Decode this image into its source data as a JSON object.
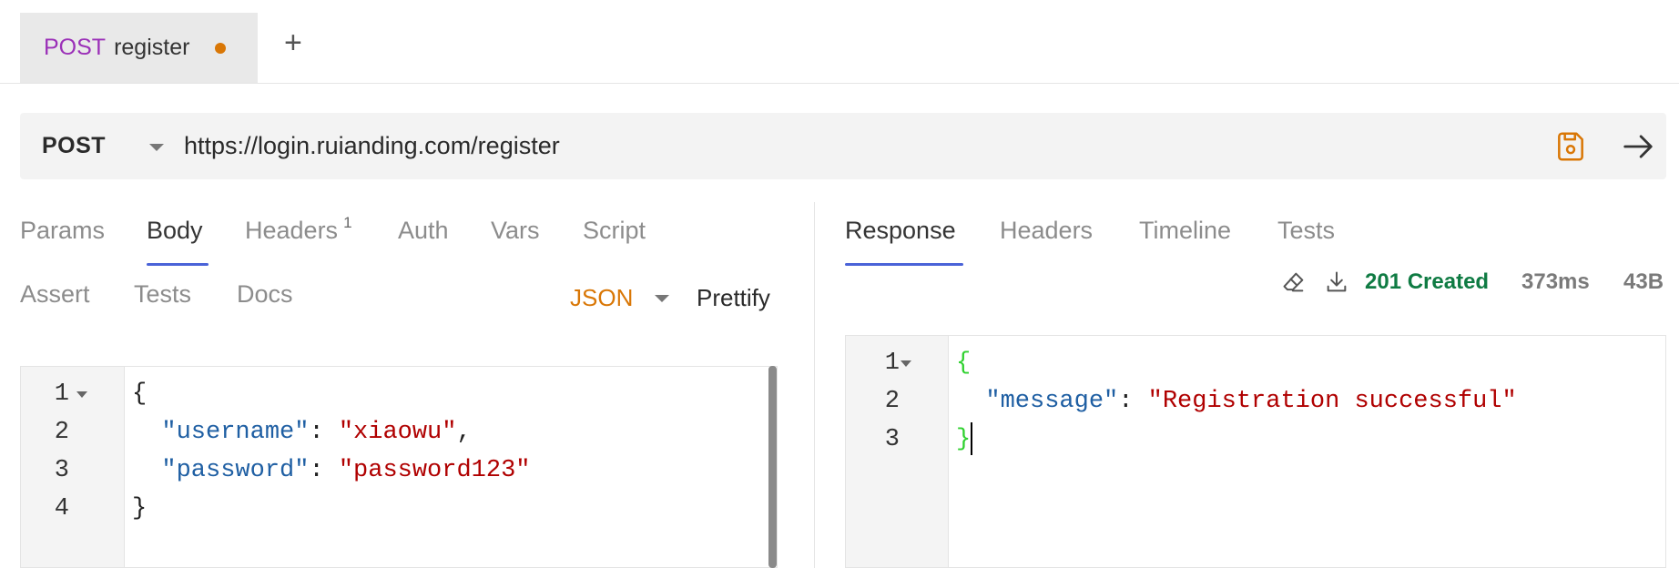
{
  "tab_strip": {
    "active_tab": {
      "method": "POST",
      "name": "register",
      "unsaved": true
    },
    "new_tab_label": "+"
  },
  "url_bar": {
    "method": "POST",
    "url": "https://login.ruianding.com/register",
    "icons": {
      "save": "save-icon",
      "send": "arrow-right-icon"
    }
  },
  "request_pane": {
    "tabs": [
      {
        "label": "Params"
      },
      {
        "label": "Body",
        "active": true
      },
      {
        "label": "Headers",
        "badge": "1"
      },
      {
        "label": "Auth"
      },
      {
        "label": "Vars"
      },
      {
        "label": "Script"
      },
      {
        "label": "Assert"
      },
      {
        "label": "Tests"
      },
      {
        "label": "Docs"
      }
    ],
    "body_mode": "JSON",
    "prettify_label": "Prettify",
    "body_lines": [
      "1",
      "2",
      "3",
      "4"
    ],
    "body": {
      "open": "{",
      "username_key": "\"username\"",
      "username_value": "\"xiaowu\"",
      "password_key": "\"password\"",
      "password_value": "\"password123\"",
      "close": "}"
    }
  },
  "response_pane": {
    "tabs": [
      {
        "label": "Response",
        "active": true
      },
      {
        "label": "Headers"
      },
      {
        "label": "Timeline"
      },
      {
        "label": "Tests"
      }
    ],
    "status": "201 Created",
    "time": "373ms",
    "size": "43B",
    "icons": {
      "clear": "eraser-icon",
      "download": "download-icon"
    },
    "status_color": "#0f7b43",
    "body_lines": [
      "1",
      "2",
      "3"
    ],
    "body": {
      "open": "{",
      "message_key": "\"message\"",
      "message_value": "\"Registration successful\"",
      "close": "}"
    }
  },
  "colors": {
    "method_post": "#9b30b8",
    "accent_underline": "#4a63d8",
    "json_orange": "#d97706",
    "json_key": "#1f5fa3",
    "json_string": "#b00000"
  }
}
